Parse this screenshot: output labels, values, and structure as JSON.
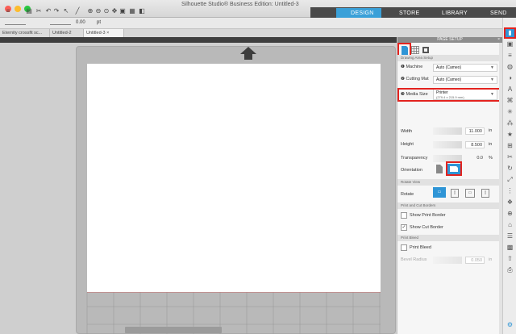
{
  "app": {
    "title": "Silhouette Studio® Business Edition: Untitled-3",
    "nav_tabs": [
      "DESIGN",
      "STORE",
      "LIBRARY",
      "SEND"
    ],
    "active_tab": "DESIGN"
  },
  "options_bar": {
    "value": "0.00",
    "unit": "pt"
  },
  "doc_tabs": [
    {
      "label": "Eternity crossfit sc..."
    },
    {
      "label": "Untitled-2"
    },
    {
      "label": "Untitled-3"
    }
  ],
  "panel": {
    "title": "PAGE SETUP",
    "close": "×",
    "section_page_area": "Drawing Area Setup",
    "machine": {
      "num": "1",
      "label": "Machine",
      "value": "Auto (Cameo)"
    },
    "cutting_mat": {
      "num": "2",
      "label": "Cutting Mat",
      "value": "Auto (Cameo)"
    },
    "media_size": {
      "num": "3",
      "label": "Media Size",
      "value": "Printer",
      "sub": "(279.4 x 215.9 mm)"
    },
    "width": {
      "label": "Width",
      "value": "11.000",
      "unit": "in"
    },
    "height": {
      "label": "Height",
      "value": "8.500",
      "unit": "in"
    },
    "transparency": {
      "label": "Transparency",
      "value": "0.0",
      "unit": "%"
    },
    "orientation": {
      "label": "Orientation"
    },
    "section_rotate": "Rotate View",
    "rotate": {
      "label": "Rotate"
    },
    "section_print_cut": "Print and Cut Borders",
    "show_print_border": {
      "label": "Show Print Border",
      "checked": false
    },
    "show_cut_border": {
      "label": "Show Cut Border",
      "checked": true
    },
    "section_print_bleed": "Print Bleed",
    "print_bleed": {
      "label": "Print Bleed",
      "checked": false
    },
    "bevel_radius": {
      "label": "Bevel Radius",
      "value": "0.050",
      "unit": "in"
    }
  },
  "colors": {
    "nav_bg": "#4a4a4a",
    "design_active": "#3aa0d8",
    "highlight": "#e3231f",
    "accent": "#2f95d6"
  }
}
